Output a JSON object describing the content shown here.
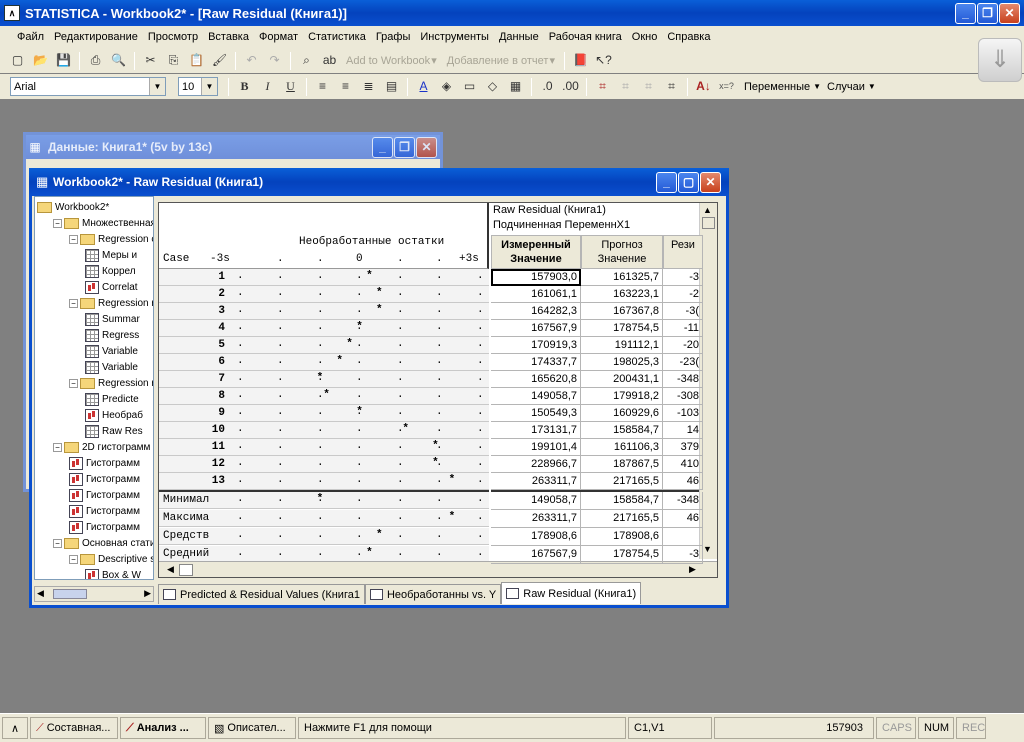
{
  "app": {
    "title": "STATISTICA - Workbook2* - [Raw Residual (Книга1)]"
  },
  "menu": [
    "Файл",
    "Редактирование",
    "Просмотр",
    "Вставка",
    "Формат",
    "Статистика",
    "Графы",
    "Инструменты",
    "Данные",
    "Рабочая книга",
    "Окно",
    "Справка"
  ],
  "toolbar1": {
    "add_to_workbook": "Add to Workbook",
    "add_to_report": "Добавление в отчет"
  },
  "toolbar2": {
    "font": "Arial",
    "size": "10",
    "bold": "B",
    "italic": "I",
    "underline": "U",
    "variables": "Переменные",
    "cases": "Случаи",
    "axis_glyph": "x=?"
  },
  "data_window": {
    "title": "Данные: Книга1* (5v by 13c)"
  },
  "workbook": {
    "title": "Workbook2* - Raw Residual (Книга1)"
  },
  "tree": [
    {
      "label": "Workbook2*",
      "level": 0,
      "type": "folder"
    },
    {
      "label": "Множественная",
      "level": 1,
      "type": "folder"
    },
    {
      "label": "Regression с",
      "level": 2,
      "type": "folder"
    },
    {
      "label": "Меры и",
      "level": 3,
      "type": "sheet"
    },
    {
      "label": "Коррел",
      "level": 3,
      "type": "sheet"
    },
    {
      "label": "Correlat",
      "level": 3,
      "type": "graph"
    },
    {
      "label": "Regression r",
      "level": 2,
      "type": "folder"
    },
    {
      "label": "Summar",
      "level": 3,
      "type": "sheet"
    },
    {
      "label": "Regress",
      "level": 3,
      "type": "sheet"
    },
    {
      "label": "Variable",
      "level": 3,
      "type": "sheet"
    },
    {
      "label": "Variable",
      "level": 3,
      "type": "sheet"
    },
    {
      "label": "Regression r",
      "level": 2,
      "type": "folder"
    },
    {
      "label": "Predicte",
      "level": 3,
      "type": "sheet"
    },
    {
      "label": "Необраб",
      "level": 3,
      "type": "graph"
    },
    {
      "label": "Raw Res",
      "level": 3,
      "type": "sheet"
    },
    {
      "label": "2D гистограмм",
      "level": 1,
      "type": "folder"
    },
    {
      "label": "Гистограмм",
      "level": 2,
      "type": "graph"
    },
    {
      "label": "Гистограмм",
      "level": 2,
      "type": "graph"
    },
    {
      "label": "Гистограмм",
      "level": 2,
      "type": "graph"
    },
    {
      "label": "Гистограмм",
      "level": 2,
      "type": "graph"
    },
    {
      "label": "Гистограмм",
      "level": 2,
      "type": "graph"
    },
    {
      "label": "Основная стати",
      "level": 1,
      "type": "folder"
    },
    {
      "label": "Descriptive s",
      "level": 2,
      "type": "folder"
    },
    {
      "label": "Box & W",
      "level": 3,
      "type": "graph"
    }
  ],
  "plot": {
    "heading": "Необработанные остатки",
    "case_label": "Case",
    "scale_left": "-3s",
    "scale_zero": "0",
    "scale_right": "+3s",
    "cases": [
      {
        "n": "1",
        "pos": 4.7
      },
      {
        "n": "2",
        "pos": 5
      },
      {
        "n": "3",
        "pos": 5
      },
      {
        "n": "4",
        "pos": 4.4
      },
      {
        "n": "5",
        "pos": 4.1
      },
      {
        "n": "6",
        "pos": 3.8
      },
      {
        "n": "7",
        "pos": 3.2
      },
      {
        "n": "8",
        "pos": 3.4
      },
      {
        "n": "9",
        "pos": 4.4
      },
      {
        "n": "10",
        "pos": 5.8
      },
      {
        "n": "11",
        "pos": 6.7
      },
      {
        "n": "12",
        "pos": 6.7
      },
      {
        "n": "13",
        "pos": 7.2
      }
    ],
    "summary": [
      {
        "label": "Минимал",
        "pos": 3.2
      },
      {
        "label": "Максима",
        "pos": 7.2
      },
      {
        "label": "Средств",
        "pos": 5
      },
      {
        "label": "Средний",
        "pos": 4.7
      }
    ]
  },
  "table": {
    "title": "Raw Residual (Книга1)",
    "dep_var": "Подчиненная ПеременнX1",
    "headers": [
      {
        "line1": "Измеренный",
        "line2": "Значение",
        "bold": true
      },
      {
        "line1": "Прогноз",
        "line2": "Значение",
        "bold": false
      },
      {
        "line1": "Рези",
        "line2": "",
        "bold": false
      }
    ],
    "rows": [
      [
        "157903,0",
        "161325,7",
        "-3"
      ],
      [
        "161061,1",
        "163223,1",
        "-2"
      ],
      [
        "164282,3",
        "167367,8",
        "-3("
      ],
      [
        "167567,9",
        "178754,5",
        "-11"
      ],
      [
        "170919,3",
        "191112,1",
        "-20"
      ],
      [
        "174337,7",
        "198025,3",
        "-23("
      ],
      [
        "165620,8",
        "200431,1",
        "-348"
      ],
      [
        "149058,7",
        "179918,2",
        "-308"
      ],
      [
        "150549,3",
        "160929,6",
        "-103"
      ],
      [
        "173131,7",
        "158584,7",
        "14"
      ],
      [
        "199101,4",
        "161106,3",
        "379"
      ],
      [
        "228966,7",
        "187867,5",
        "410"
      ],
      [
        "263311,7",
        "217165,5",
        "46"
      ]
    ],
    "summary_rows": [
      [
        "149058,7",
        "158584,7",
        "-348"
      ],
      [
        "263311,7",
        "217165,5",
        "46"
      ],
      [
        "178908,6",
        "178908,6",
        ""
      ],
      [
        "167567,9",
        "178754,5",
        "-3"
      ]
    ]
  },
  "tabs": [
    {
      "label": "Predicted & Residual Values (Книга1",
      "active": false
    },
    {
      "label": "Необработанны vs. Y",
      "active": false
    },
    {
      "label": "Raw Residual (Книга1)",
      "active": true
    }
  ],
  "statusbar": {
    "tasks": [
      "Составная...",
      "Анализ ...",
      "Описател..."
    ],
    "help": "Нажмите F1 для помощи",
    "cellref": "C1,V1",
    "value": "157903",
    "caps": "CAPS",
    "num": "NUM",
    "rec": "REC"
  },
  "colors": {
    "xp_blue": "#0a4fcf",
    "face": "#ece9d8",
    "desktop": "#808080"
  }
}
